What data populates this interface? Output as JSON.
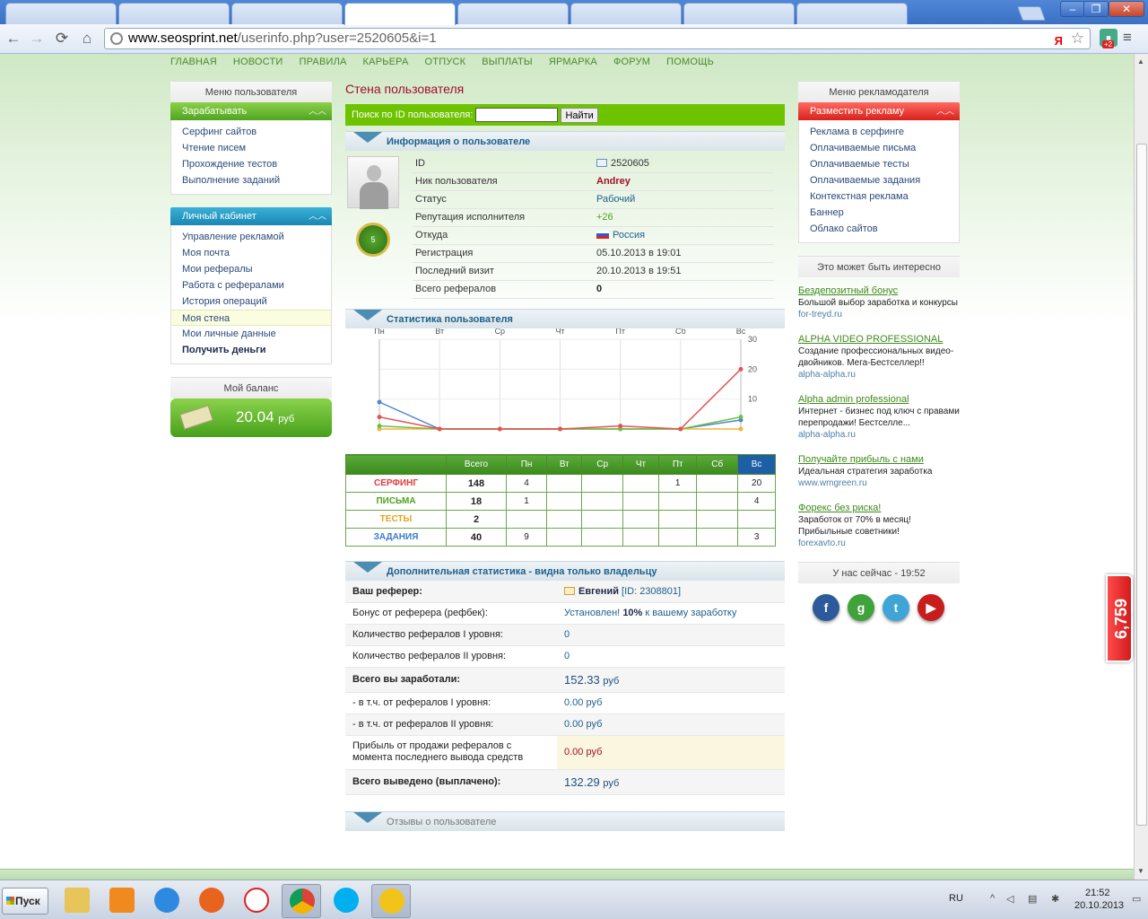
{
  "browser": {
    "tabs": [
      {
        "label": ""
      },
      {
        "label": ""
      },
      {
        "label": ""
      },
      {
        "label": ""
      },
      {
        "label": ""
      },
      {
        "label": ""
      },
      {
        "label": ""
      },
      {
        "label": ""
      }
    ],
    "active_tab": 3,
    "url_host": "www.seosprint.net",
    "url_path": "/userinfo.php?user=2520605&i=1",
    "ext_badge": "+2",
    "win_min": "–",
    "win_max": "❐",
    "win_close": "✕"
  },
  "topnav": [
    "ГЛАВНАЯ",
    "НОВОСТИ",
    "ПРАВИЛА",
    "КАРЬЕРА",
    "ОТПУСК",
    "ВЫПЛАТЫ",
    "ЯРМАРКА",
    "ФОРУМ",
    "ПОМОЩЬ"
  ],
  "left": {
    "user_menu_title": "Меню пользователя",
    "earn": {
      "title": "Зарабатывать",
      "items": [
        "Серфинг сайтов",
        "Чтение писем",
        "Прохождение тестов",
        "Выполнение заданий"
      ]
    },
    "cabinet": {
      "title": "Личный кабинет",
      "items": [
        "Управление рекламой",
        "Моя почта",
        "Мои рефералы",
        "Работа с рефералами",
        "История операций",
        "Моя стена",
        "Мои личные данные",
        "Получить деньги"
      ]
    },
    "balance_title": "Мой баланс",
    "balance_amount": "20.04",
    "balance_currency": "руб"
  },
  "main": {
    "page_title": "Стена пользователя",
    "search_label": "Поиск по ID пользователя:",
    "search_value": "",
    "search_button": "Найти",
    "info_title": "Информация о пользователе",
    "info_rows": [
      {
        "k": "ID",
        "v": "2520605"
      },
      {
        "k": "Ник пользователя",
        "v": "Andrey"
      },
      {
        "k": "Статус",
        "v": "Рабочий"
      },
      {
        "k": "Репутация исполнителя",
        "v": "+26"
      },
      {
        "k": "Откуда",
        "v": "Россия"
      },
      {
        "k": "Регистрация",
        "v": "05.10.2013 в 19:01"
      },
      {
        "k": "Последний визит",
        "v": "20.10.2013 в 19:51"
      },
      {
        "k": "Всего рефералов",
        "v": "0"
      }
    ],
    "medal_label": "5",
    "stats_title": "Статистика пользователя",
    "table_headers": [
      "",
      "Всего",
      "Пн",
      "Вт",
      "Ср",
      "Чт",
      "Пт",
      "Сб",
      "Вс"
    ],
    "table_rows": [
      {
        "name": "СЕРФИНГ",
        "color": "#e23b3b",
        "total": "148",
        "cells": [
          "4",
          "",
          "",
          "",
          "1",
          "",
          "20"
        ]
      },
      {
        "name": "ПИСЬМА",
        "color": "#4ca51c",
        "total": "18",
        "cells": [
          "1",
          "",
          "",
          "",
          "",
          "",
          "4"
        ]
      },
      {
        "name": "ТЕСТЫ",
        "color": "#e2a51c",
        "total": "2",
        "cells": [
          "",
          "",
          "",
          "",
          "",
          "",
          ""
        ]
      },
      {
        "name": "ЗАДАНИЯ",
        "color": "#3b7bd0",
        "total": "40",
        "cells": [
          "9",
          "",
          "",
          "",
          "",
          "",
          "3"
        ]
      }
    ],
    "extra_title": "Дополнительная статистика - видна только владельцу",
    "extra": {
      "referrer_k": "Ваш реферер:",
      "referrer_name": "Евгений",
      "referrer_id": "[ID: 2308801]",
      "bonus_k": "Бонус от реферера (рефбек):",
      "bonus_v1": "Установлен!",
      "bonus_pct": "10%",
      "bonus_v2": "к вашему заработку",
      "ref1_k": "Количество рефералов I уровня:",
      "ref1_v": "0",
      "ref2_k": "Количество рефералов II уровня:",
      "ref2_v": "0",
      "earned_k": "Всего вы заработали:",
      "earned_v": "152.33",
      "from1_k": "- в т.ч. от рефералов I уровня:",
      "from1_v": "0.00 руб",
      "from2_k": "- в т.ч. от рефералов II уровня:",
      "from2_v": "0.00 руб",
      "sale_k": "Прибыль от продажи рефералов с момента последнего вывода средств",
      "sale_v": "0.00 руб",
      "paid_k": "Всего выведено (выплачено):",
      "paid_v": "132.29",
      "cur": "руб"
    },
    "reviews_title": "Отзывы о пользователе"
  },
  "right": {
    "adv_menu_title": "Меню рекламодателя",
    "place": {
      "title": "Разместить рекламу",
      "items": [
        "Реклама в серфинге",
        "Оплачиваемые письма",
        "Оплачиваемые тесты",
        "Оплачиваемые задания",
        "Контекстная реклама",
        "Баннер",
        "Облако сайтов"
      ]
    },
    "interest_title": "Это может быть интересно",
    "ads": [
      {
        "t": "Бездепозитный бонус",
        "d": "Большой выбор заработка и конкурсы",
        "u": "for-treyd.ru"
      },
      {
        "t": "ALPHA VIDEO PROFESSIONAL",
        "d": "Создание профессиональных видео-двойников. Мега-Бестселлер!!",
        "u": "alpha-alpha.ru"
      },
      {
        "t": "Alpha admin professional",
        "d": "Интернет - бизнес под ключ с правами перепродажи! Бестселле...",
        "u": "alpha-alpha.ru"
      },
      {
        "t": "Получайте прибыль с нами",
        "d": "Идеальная стратегия заработка",
        "u": "www.wmgreen.ru"
      },
      {
        "t": "Форекс без риска!",
        "d": "Заработок от 70% в месяц! Прибыльные советники!",
        "u": "forexavto.ru"
      }
    ],
    "now_title": "У нас сейчас - 19:52",
    "social": [
      {
        "icon": "facebook-icon",
        "glyph": "f",
        "color": "#2d5a9a"
      },
      {
        "icon": "google-plus-icon",
        "glyph": "g",
        "color": "#3fa23a"
      },
      {
        "icon": "twitter-icon",
        "glyph": "t",
        "color": "#3fa4d6"
      },
      {
        "icon": "youtube-icon",
        "glyph": "▶",
        "color": "#c81d1d"
      }
    ]
  },
  "counter": "6,759",
  "taskbar": {
    "start": "Пуск",
    "lang": "RU",
    "time": "21:52",
    "date": "20.10.2013"
  },
  "chart_data": {
    "type": "line",
    "categories": [
      "Пн",
      "Вт",
      "Ср",
      "Чт",
      "Пт",
      "Сб",
      "Вс"
    ],
    "yticks": [
      10,
      20,
      30
    ],
    "ylim": [
      0,
      30
    ],
    "grid": true,
    "series": [
      {
        "name": "СЕРФИНГ",
        "color": "#e55454",
        "values": [
          4,
          0,
          0,
          0,
          1,
          0,
          20
        ]
      },
      {
        "name": "ПИСЬМА",
        "color": "#6cc04a",
        "values": [
          1,
          0,
          0,
          0,
          0,
          0,
          4
        ]
      },
      {
        "name": "ТЕСТЫ",
        "color": "#f0b53a",
        "values": [
          0,
          0,
          0,
          0,
          0,
          0,
          0
        ]
      },
      {
        "name": "ЗАДАНИЯ",
        "color": "#4f84d4",
        "values": [
          9,
          0,
          0,
          0,
          0,
          0,
          3
        ]
      }
    ]
  }
}
